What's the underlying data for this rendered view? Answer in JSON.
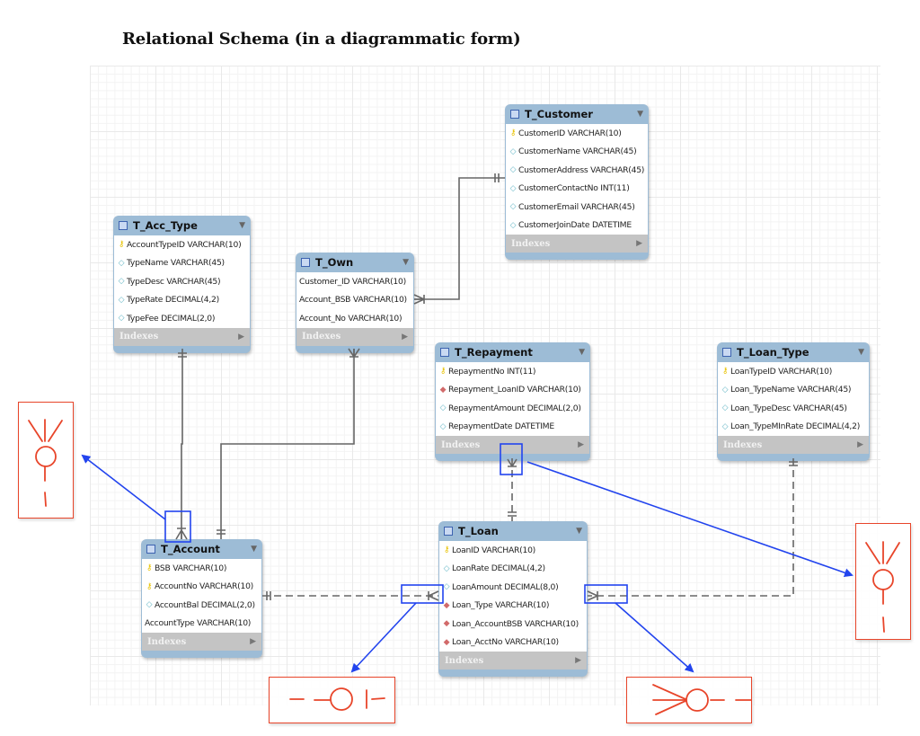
{
  "title": "Relational Schema (in a diagrammatic form)",
  "tables": {
    "customer": {
      "name": "T_Customer",
      "columns": [
        {
          "key": "pk",
          "text": "CustomerID VARCHAR(10)"
        },
        {
          "key": "attr",
          "text": "CustomerName VARCHAR(45)"
        },
        {
          "key": "attr",
          "text": "CustomerAddress VARCHAR(45)"
        },
        {
          "key": "attr",
          "text": "CustomerContactNo INT(11)"
        },
        {
          "key": "attr",
          "text": "CustomerEmail VARCHAR(45)"
        },
        {
          "key": "attr",
          "text": "CustomerJoinDate DATETIME"
        }
      ],
      "indexes_label": "Indexes"
    },
    "acc_type": {
      "name": "T_Acc_Type",
      "columns": [
        {
          "key": "pk",
          "text": "AccountTypeID VARCHAR(10)"
        },
        {
          "key": "attr",
          "text": "TypeName VARCHAR(45)"
        },
        {
          "key": "attr",
          "text": "TypeDesc VARCHAR(45)"
        },
        {
          "key": "attr",
          "text": "TypeRate DECIMAL(4,2)"
        },
        {
          "key": "attr",
          "text": "TypeFee DECIMAL(2,0)"
        }
      ],
      "indexes_label": "Indexes"
    },
    "own": {
      "name": "T_Own",
      "columns": [
        {
          "key": "none",
          "text": "Customer_ID VARCHAR(10)"
        },
        {
          "key": "none",
          "text": "Account_BSB VARCHAR(10)"
        },
        {
          "key": "none",
          "text": "Account_No VARCHAR(10)"
        }
      ],
      "indexes_label": "Indexes"
    },
    "repayment": {
      "name": "T_Repayment",
      "columns": [
        {
          "key": "pk",
          "text": "RepaymentNo INT(11)"
        },
        {
          "key": "fk",
          "text": "Repayment_LoanID VARCHAR(10)"
        },
        {
          "key": "attr",
          "text": "RepaymentAmount DECIMAL(2,0)"
        },
        {
          "key": "attr",
          "text": "RepaymentDate DATETIME"
        }
      ],
      "indexes_label": "Indexes"
    },
    "loan_type": {
      "name": "T_Loan_Type",
      "columns": [
        {
          "key": "pk",
          "text": "LoanTypeID VARCHAR(10)"
        },
        {
          "key": "attr",
          "text": "Loan_TypeName VARCHAR(45)"
        },
        {
          "key": "attr",
          "text": "Loan_TypeDesc VARCHAR(45)"
        },
        {
          "key": "attr",
          "text": "Loan_TypeMInRate DECIMAL(4,2)"
        }
      ],
      "indexes_label": "Indexes"
    },
    "account": {
      "name": "T_Account",
      "columns": [
        {
          "key": "pk",
          "text": "BSB VARCHAR(10)"
        },
        {
          "key": "pk",
          "text": "AccountNo VARCHAR(10)"
        },
        {
          "key": "attr",
          "text": "AccountBal DECIMAL(2,0)"
        },
        {
          "key": "none",
          "text": "AccountType VARCHAR(10)"
        }
      ],
      "indexes_label": "Indexes"
    },
    "loan": {
      "name": "T_Loan",
      "columns": [
        {
          "key": "pk",
          "text": "LoanID VARCHAR(10)"
        },
        {
          "key": "attr",
          "text": "LoanRate DECIMAL(4,2)"
        },
        {
          "key": "attr",
          "text": "LoanAmount DECIMAL(8,0)"
        },
        {
          "key": "fk",
          "text": "Loan_Type VARCHAR(10)"
        },
        {
          "key": "fk",
          "text": "Loan_AccountBSB VARCHAR(10)"
        },
        {
          "key": "fk",
          "text": "Loan_AcctNo VARCHAR(10)"
        }
      ],
      "indexes_label": "Indexes"
    }
  },
  "icons": {
    "table": "table-icon",
    "pk": "key-icon",
    "fk": "foreign-key-diamond-icon",
    "attr": "attribute-diamond-icon",
    "caret": "▼",
    "arrow": "▶"
  },
  "relationships": [
    {
      "from": "T_Acc_Type",
      "to": "T_Account",
      "style": "solid",
      "from_end": "one-and-only-one",
      "to_end": "one-or-many"
    },
    {
      "from": "T_Own",
      "to": "T_Account",
      "style": "solid",
      "from_end": "one-or-many",
      "to_end": "one-and-only-one"
    },
    {
      "from": "T_Customer",
      "to": "T_Own",
      "style": "solid",
      "from_end": "one-and-only-one",
      "to_end": "one-or-many"
    },
    {
      "from": "T_Account",
      "to": "T_Loan",
      "style": "dashed",
      "from_end": "one-and-only-one",
      "to_end": "zero-or-many"
    },
    {
      "from": "T_Loan",
      "to": "T_Repayment",
      "style": "dashed",
      "from_end": "one-and-only-one",
      "to_end": "zero-or-many"
    },
    {
      "from": "T_Loan_Type",
      "to": "T_Loan",
      "style": "dashed",
      "from_end": "one-and-only-one",
      "to_end": "zero-or-many"
    }
  ],
  "annotations": [
    {
      "name": "note-left",
      "symbol": "zero-or-many (vertical)"
    },
    {
      "name": "note-right",
      "symbol": "zero-or-many (vertical)"
    },
    {
      "name": "note-bottom-left",
      "symbol": "zero-or-one (horizontal)"
    },
    {
      "name": "note-bottom-right",
      "symbol": "zero-or-many (horizontal)"
    }
  ],
  "colors": {
    "table_header": "#9dbcd6",
    "indexes_bar": "#c4c4c4",
    "connector": "#666666",
    "highlight": "#2244ee",
    "annotation": "#e8452a"
  }
}
